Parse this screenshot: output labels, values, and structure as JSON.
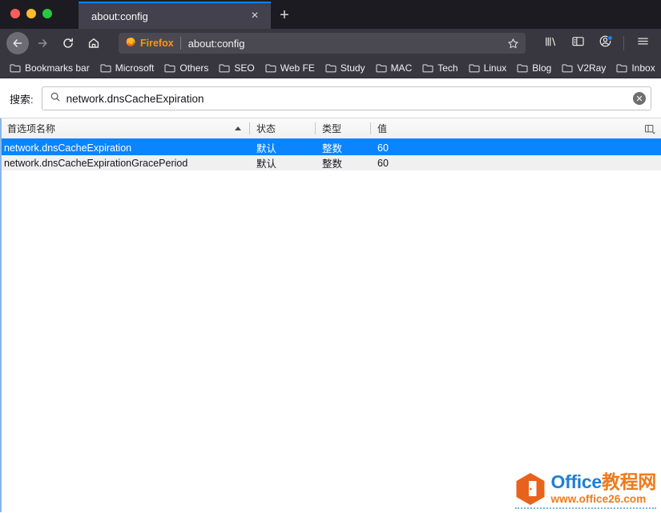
{
  "window": {
    "traffic_lights": [
      {
        "name": "close",
        "color": "#ff5f57"
      },
      {
        "name": "minimize",
        "color": "#febc2e"
      },
      {
        "name": "maximize",
        "color": "#28c840"
      }
    ]
  },
  "tabs": {
    "active_tab_title": "about:config",
    "close_glyph": "×",
    "new_tab_glyph": "+"
  },
  "navbar": {
    "back_icon": "back-arrow-icon",
    "forward_icon": "forward-arrow-icon",
    "reload_icon": "reload-icon",
    "home_icon": "home-icon",
    "brand_label": "Firefox",
    "url": "about:config",
    "bookmark_star_icon": "star-icon",
    "library_icon": "library-icon",
    "sidebar_icon": "sidebar-icon",
    "account_icon": "account-icon",
    "menu_icon": "hamburger-menu-icon"
  },
  "bookmarks_bar": {
    "items": [
      {
        "label": "Bookmarks bar"
      },
      {
        "label": "Microsoft"
      },
      {
        "label": "Others"
      },
      {
        "label": "SEO"
      },
      {
        "label": "Web FE"
      },
      {
        "label": "Study"
      },
      {
        "label": "MAC"
      },
      {
        "label": "Tech"
      },
      {
        "label": "Linux"
      },
      {
        "label": "Blog"
      },
      {
        "label": "V2Ray"
      },
      {
        "label": "Inbox"
      }
    ]
  },
  "search": {
    "label": "搜索:",
    "value": "network.dnsCacheExpiration",
    "placeholder": "",
    "search_icon": "search-icon",
    "clear_icon": "clear-circle-icon",
    "clear_glyph": "✕"
  },
  "table": {
    "columns": [
      {
        "key": "name",
        "label": "首选项名称",
        "sorted": "asc"
      },
      {
        "key": "state",
        "label": "状态"
      },
      {
        "key": "type",
        "label": "类型"
      },
      {
        "key": "value",
        "label": "值"
      }
    ],
    "column_picker_icon": "column-picker-icon",
    "rows": [
      {
        "name": "network.dnsCacheExpiration",
        "state": "默认",
        "type": "整数",
        "value": "60",
        "selected": true
      },
      {
        "name": "network.dnsCacheExpirationGracePeriod",
        "state": "默认",
        "type": "整数",
        "value": "60",
        "selected": false
      }
    ]
  },
  "watermark": {
    "brand_office": "Office",
    "brand_cn": "教程网",
    "url": "www.office26.com"
  },
  "colors": {
    "accent_blue": "#0a84ff",
    "firefox_orange": "#ff9500",
    "chrome_dark": "#38373f",
    "titlebar_dark": "#1c1b22"
  }
}
